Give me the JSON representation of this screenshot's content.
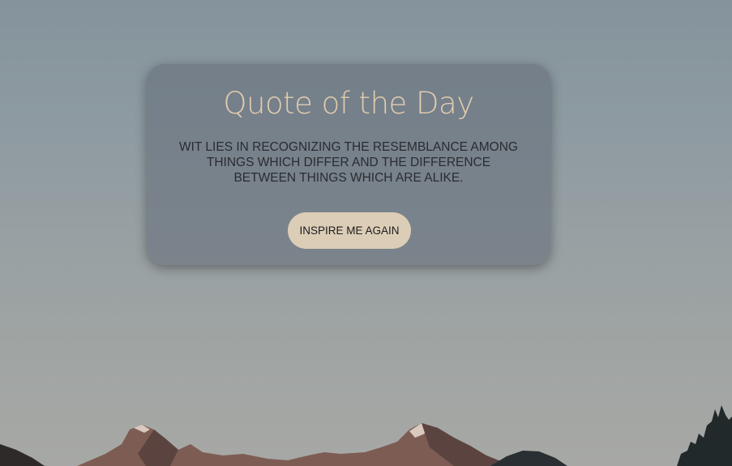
{
  "quote_card": {
    "title": "Quote of the Day",
    "quote": "WIT LIES IN RECOGNIZING THE RESEMBLANCE AMONG THINGS WHICH DIFFER AND THE DIFFERENCE BETWEEN THINGS WHICH ARE ALIKE.",
    "button_label": "INSPIRE ME AGAIN"
  },
  "colors": {
    "title": "#e3ccae",
    "button_bg": "#dccdb7",
    "card_bg": "#626c78"
  }
}
